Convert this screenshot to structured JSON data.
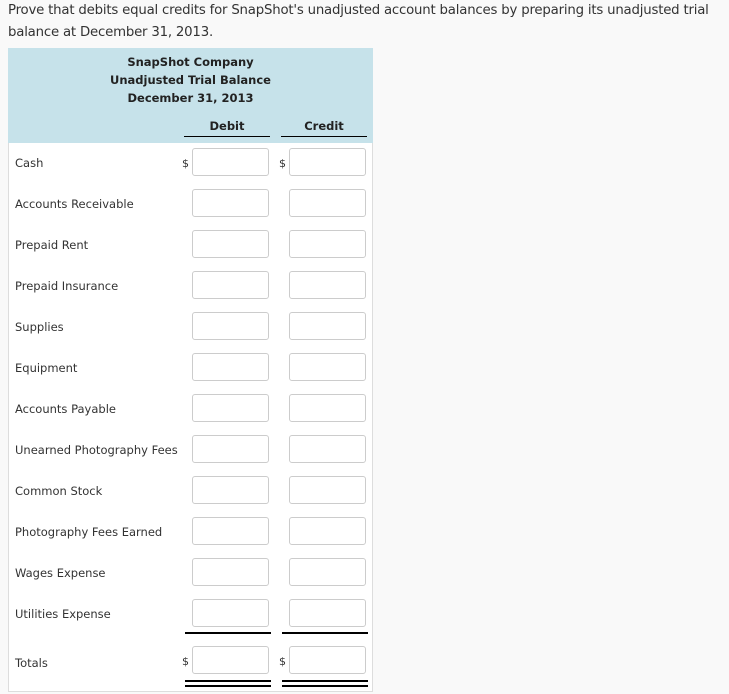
{
  "prompt": "Prove that debits equal credits for SnapShot's unadjusted account balances by preparing its unadjusted trial balance at December 31, 2013.",
  "trial_balance": {
    "company": "SnapShot Company",
    "title": "Unadjusted Trial Balance",
    "date": "December 31, 2013",
    "columns": {
      "debit": "Debit",
      "credit": "Credit"
    },
    "currency_symbol": "$",
    "accounts": [
      {
        "label": "Cash",
        "debit": "",
        "credit": "",
        "show_dollar": true
      },
      {
        "label": "Accounts Receivable",
        "debit": "",
        "credit": "",
        "show_dollar": false
      },
      {
        "label": "Prepaid Rent",
        "debit": "",
        "credit": "",
        "show_dollar": false
      },
      {
        "label": "Prepaid Insurance",
        "debit": "",
        "credit": "",
        "show_dollar": false
      },
      {
        "label": "Supplies",
        "debit": "",
        "credit": "",
        "show_dollar": false
      },
      {
        "label": "Equipment",
        "debit": "",
        "credit": "",
        "show_dollar": false
      },
      {
        "label": "Accounts Payable",
        "debit": "",
        "credit": "",
        "show_dollar": false
      },
      {
        "label": "Unearned Photography Fees",
        "debit": "",
        "credit": "",
        "show_dollar": false
      },
      {
        "label": "Common Stock",
        "debit": "",
        "credit": "",
        "show_dollar": false
      },
      {
        "label": "Photography Fees Earned",
        "debit": "",
        "credit": "",
        "show_dollar": false
      },
      {
        "label": "Wages Expense",
        "debit": "",
        "credit": "",
        "show_dollar": false
      },
      {
        "label": "Utilities Expense",
        "debit": "",
        "credit": "",
        "show_dollar": false
      }
    ],
    "totals": {
      "label": "Totals",
      "debit": "",
      "credit": ""
    }
  }
}
